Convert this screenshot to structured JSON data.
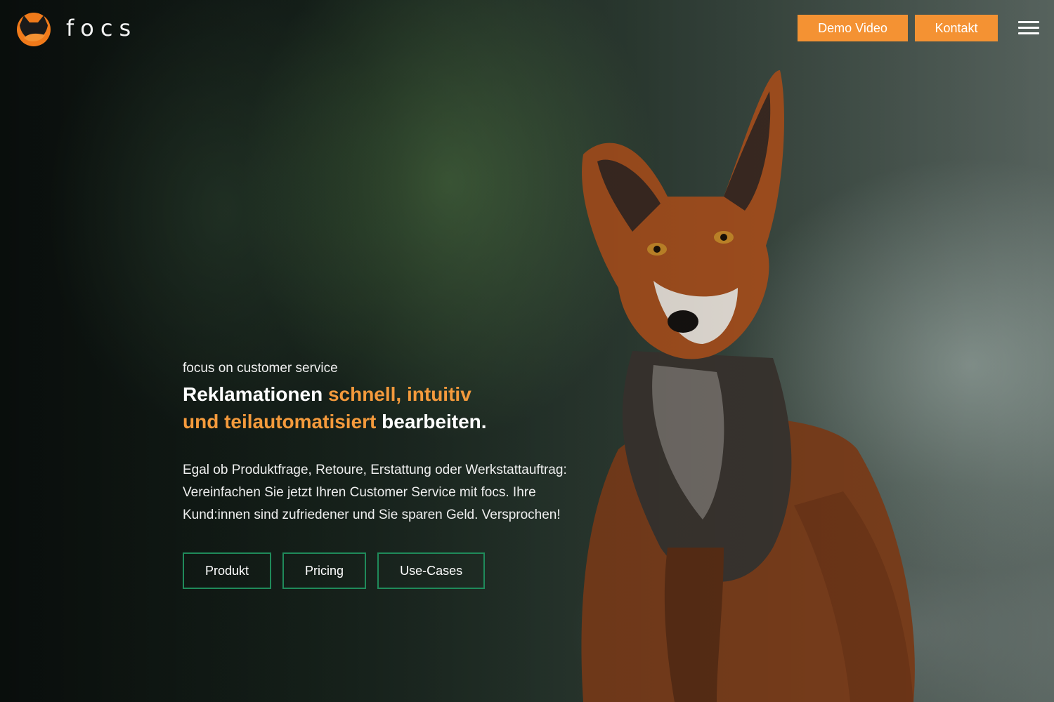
{
  "brand": {
    "name": "focs",
    "accent_color": "#f49233",
    "secondary_color": "#1f8a5a"
  },
  "header": {
    "logo_icon": "fox-logo-icon",
    "buttons": [
      {
        "label": "Demo Video"
      },
      {
        "label": "Kontakt"
      }
    ],
    "menu_icon": "hamburger-menu-icon"
  },
  "hero": {
    "tagline": "focus on customer service",
    "headline": {
      "part1": "Reklamationen ",
      "accent1": "schnell, intuitiv",
      "accent2": "und teilautomatisiert",
      "part2": " bearbeiten."
    },
    "description": "Egal ob Produktfrage, Retoure, Erstattung oder Werkstattauftrag: Vereinfachen Sie jetzt Ihren Customer Service mit focs. Ihre Kund:innen sind zufriedener und Sie sparen Geld. Versprochen!",
    "nav_buttons": [
      {
        "label": "Produkt"
      },
      {
        "label": "Pricing"
      },
      {
        "label": "Use-Cases"
      }
    ]
  }
}
